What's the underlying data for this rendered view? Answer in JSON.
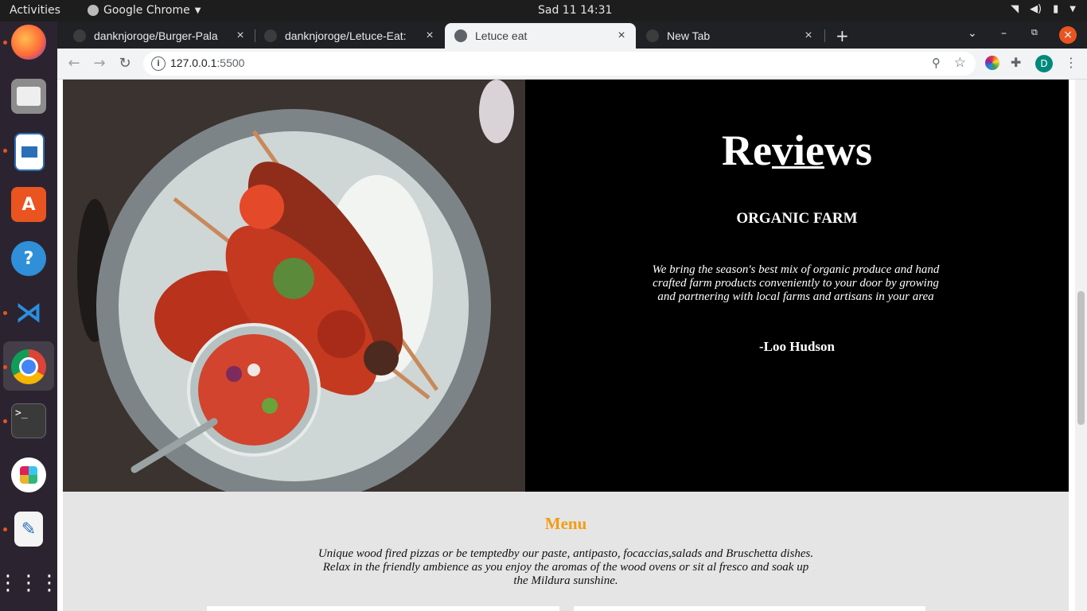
{
  "os": {
    "activities": "Activities",
    "app_name": "Google Chrome",
    "clock": "Sad 11  14:31"
  },
  "browser": {
    "tabs": [
      {
        "title": "danknjoroge/Burger-Pala",
        "active": false
      },
      {
        "title": "danknjoroge/Letuce-Eat:",
        "active": false
      },
      {
        "title": "Letuce eat",
        "active": true
      },
      {
        "title": "New Tab",
        "active": false
      }
    ],
    "url_host": "127.0.0.1",
    "url_port": ":5500",
    "profile_initial": "D"
  },
  "reviews": {
    "heading_pre": "Re",
    "heading_ul": "vie",
    "heading_post": "ws",
    "farm": "ORGANIC FARM",
    "text": "We bring the season's best mix of organic produce and hand crafted farm products conveniently to your door by growing and partnering with local farms and artisans in your area",
    "author": "-Loo Hudson"
  },
  "menu": {
    "title": "Menu",
    "description": "Unique wood fired pizzas or be temptedby our paste, antipasto, focaccias,salads and Bruschetta dishes. Relax in the friendly ambience as you enjoy the aromas of the wood ovens or sit al fresco and soak up the Mildura sunshine."
  },
  "colors": {
    "menu_title": "#f39c12",
    "review_bg": "#000000",
    "menu_bg": "#e5e5e5",
    "ubuntu_orange": "#e95420"
  },
  "icons": {
    "dock": [
      "firefox-icon",
      "files-icon",
      "libreoffice-writer-icon",
      "ubuntu-software-icon",
      "help-icon",
      "vscode-icon",
      "chrome-icon",
      "terminal-icon",
      "slack-icon",
      "text-editor-icon",
      "app-grid-icon"
    ]
  }
}
